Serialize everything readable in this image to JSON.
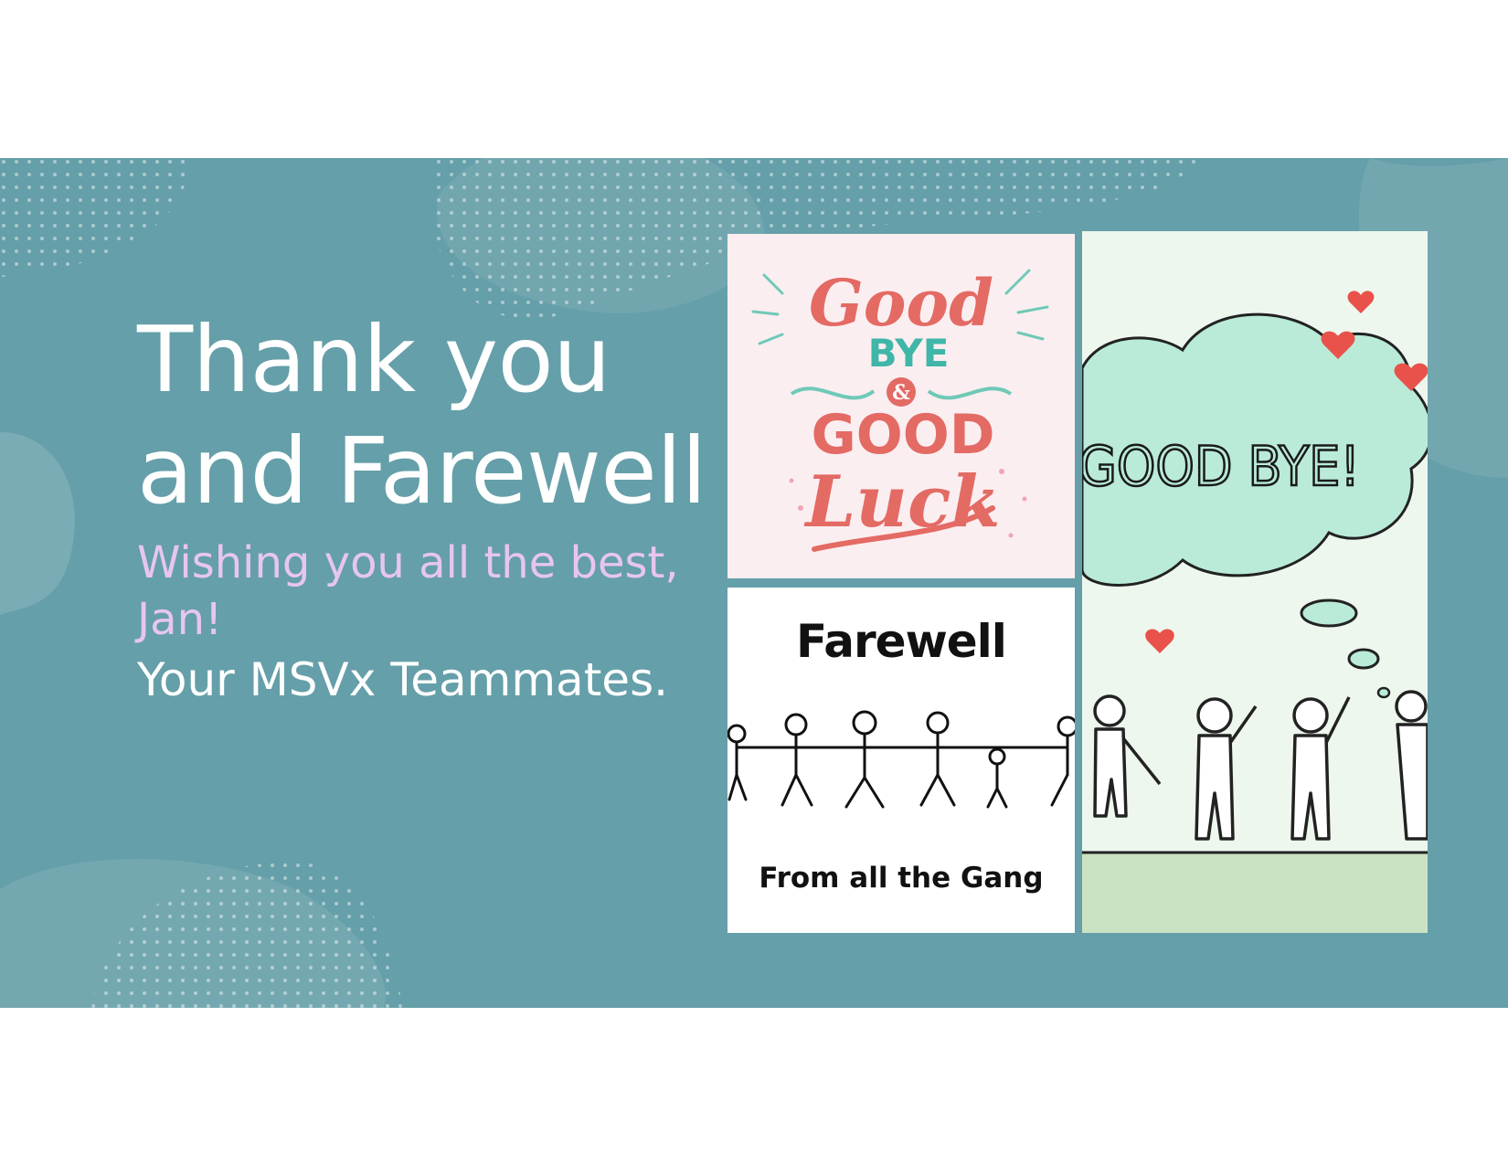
{
  "slide": {
    "title_line1": "Thank you",
    "title_line2": "and Farewell",
    "subtitle": "Wishing you all the best, Jan!",
    "signature": "Your MSVx Teammates."
  },
  "images": {
    "lettering_card": {
      "word_good": "Good",
      "word_bye": "BYE",
      "amp": "&",
      "word_good2": "GOOD",
      "word_luck": "Luck"
    },
    "farewell_card": {
      "title": "Farewell",
      "caption": "From all the Gang"
    },
    "goodbye_card": {
      "bubble_text": "GOOD BYE!"
    }
  },
  "colors": {
    "background": "#659fa9",
    "title": "#ffffff",
    "subtitle": "#e7c6ee",
    "coral": "#e46a64",
    "mint": "#6fc9b7"
  }
}
